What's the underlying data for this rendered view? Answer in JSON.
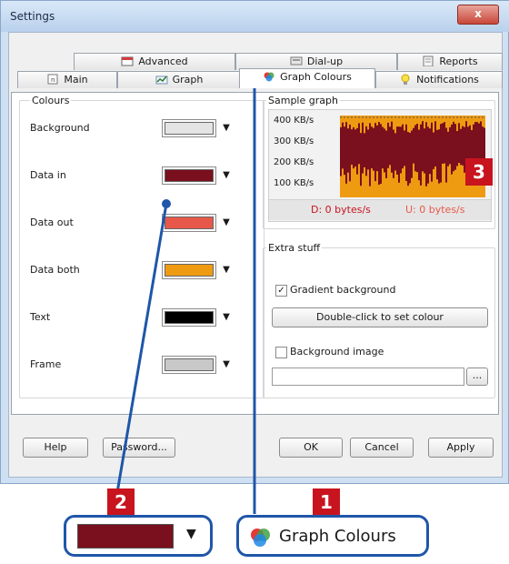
{
  "window": {
    "title": "Settings",
    "close_glyph": "x"
  },
  "tabs_row1": [
    {
      "label": "Advanced",
      "icon": "calendar-icon"
    },
    {
      "label": "Dial-up",
      "icon": "dialup-icon"
    },
    {
      "label": "Reports",
      "icon": "reports-icon"
    }
  ],
  "tabs_row2": [
    {
      "label": "Main",
      "icon": "main-icon"
    },
    {
      "label": "Graph",
      "icon": "graph-icon"
    },
    {
      "label": "Graph Colours",
      "icon": "palette-icon",
      "active": true
    },
    {
      "label": "Notifications",
      "icon": "lightbulb-icon"
    }
  ],
  "colours": {
    "title": "Colours",
    "rows": [
      {
        "label": "Background",
        "color": "#e4e4e4"
      },
      {
        "label": "Data in",
        "color": "#7a0f1d"
      },
      {
        "label": "Data out",
        "color": "#e8584a"
      },
      {
        "label": "Data both",
        "color": "#ef9b12"
      },
      {
        "label": "Text",
        "color": "#000000"
      },
      {
        "label": "Frame",
        "color": "#c8c8c8"
      }
    ]
  },
  "sample": {
    "title": "Sample graph",
    "y_labels": [
      "400 KB/s",
      "300 KB/s",
      "200 KB/s",
      "100 KB/s"
    ],
    "down": "D: 0 bytes/s",
    "up": "U: 0 bytes/s",
    "colors": {
      "in": "#7a0f1d",
      "both": "#ef9b12",
      "down_text": "#c8141e",
      "up_text": "#e8584a"
    }
  },
  "extra": {
    "title": "Extra stuff",
    "gradient_label": "Gradient background",
    "gradient_checked": "✓",
    "set_colour_label": "Double-click to set colour",
    "bg_image_label": "Background image",
    "browse_label": "..."
  },
  "buttons": {
    "help": "Help",
    "password": "Password...",
    "ok": "OK",
    "cancel": "Cancel",
    "apply": "Apply"
  },
  "callouts": {
    "one": "1",
    "two": "2",
    "three": "3",
    "zoom_tab_label": "Graph Colours",
    "zoom_swatch_color": "#7a0f1d",
    "accent": "#1f56a8"
  }
}
